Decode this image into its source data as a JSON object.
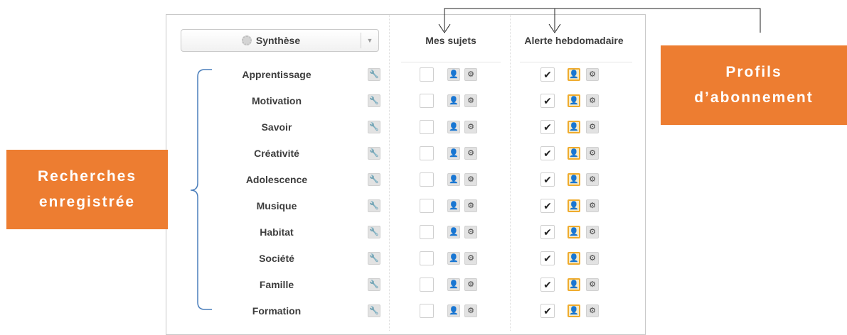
{
  "panel": {
    "dropdown": {
      "label": "Synthèse",
      "gear_icon": "gear-icon",
      "arrow_icon": "triangle-down-icon"
    },
    "columns": {
      "mes_sujets": "Mes sujets",
      "alerte": "Alerte hebdomadaire"
    },
    "rows": [
      {
        "label": "Apprentissage",
        "mes_sujets_checked": false,
        "alerte_checked": true
      },
      {
        "label": "Motivation",
        "mes_sujets_checked": false,
        "alerte_checked": true
      },
      {
        "label": "Savoir",
        "mes_sujets_checked": false,
        "alerte_checked": true
      },
      {
        "label": "Créativité",
        "mes_sujets_checked": false,
        "alerte_checked": true
      },
      {
        "label": "Adolescence",
        "mes_sujets_checked": false,
        "alerte_checked": true
      },
      {
        "label": "Musique",
        "mes_sujets_checked": false,
        "alerte_checked": true
      },
      {
        "label": "Habitat",
        "mes_sujets_checked": false,
        "alerte_checked": true
      },
      {
        "label": "Société",
        "mes_sujets_checked": false,
        "alerte_checked": true
      },
      {
        "label": "Famille",
        "mes_sujets_checked": false,
        "alerte_checked": true
      },
      {
        "label": "Formation",
        "mes_sujets_checked": false,
        "alerte_checked": true
      }
    ],
    "icons": {
      "edit": "wrench-icon",
      "profile": "user-icon",
      "settings": "gear-icon",
      "check": "check-icon"
    }
  },
  "callouts": {
    "left": {
      "line1": "Recherches",
      "line2": "enregistrée"
    },
    "right": {
      "line1": "Profils",
      "line2": "d’abonnement"
    }
  },
  "colors": {
    "callout_bg": "#ed7d31",
    "active_border": "#efab2d",
    "bracket": "#4a7ebb"
  }
}
